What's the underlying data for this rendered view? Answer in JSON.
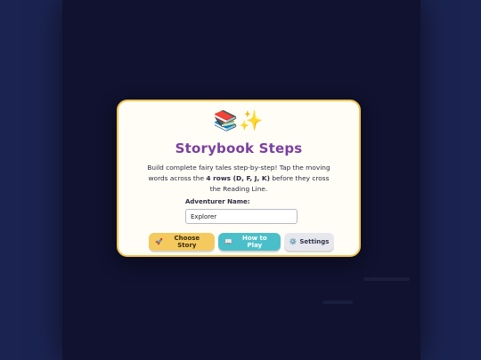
{
  "colors": {
    "page_bg": "#1b2350",
    "stage_bg": "#14173a",
    "modal_bg": "#fffdf5",
    "modal_border": "#f2c14e",
    "title": "#7b3fa0",
    "choose_story_bg": "#f4c95d",
    "how_to_play_bg": "#4bbfc9",
    "settings_bg": "#e7e7ee"
  },
  "modal": {
    "hero_icons": "📚✨",
    "title": "Storybook Steps",
    "description": {
      "part1": "Build complete fairy tales step-by-step! Tap the moving words across the ",
      "bold": "4 rows (D, F, J, K)",
      "part2": " before they cross the Reading Line."
    },
    "name_label": "Adventurer Name:",
    "name_value": "Explorer",
    "buttons": {
      "choose_story": {
        "icon": "🚀",
        "label": "Choose Story"
      },
      "how_to_play": {
        "icon": "📖",
        "label": "How to Play"
      },
      "settings": {
        "icon": "⚙️",
        "label": "Settings"
      }
    }
  }
}
